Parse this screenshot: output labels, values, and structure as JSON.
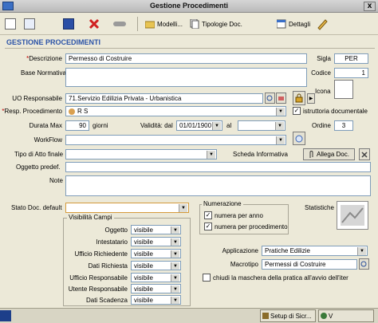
{
  "window": {
    "title": "Gestione Procedimenti",
    "close_glyph": "x"
  },
  "toolbar": {
    "items": [
      {
        "name": "new-icon"
      },
      {
        "name": "new-copy-icon"
      },
      {
        "name": "save-icon"
      },
      {
        "name": "delete-icon"
      },
      {
        "name": "handshake-icon"
      }
    ],
    "modelli_label": "Modelli...",
    "tipologie_label": "Tipologie Doc.",
    "dettagli_label": "Dettagli"
  },
  "section_title": "GESTIONE PROCEDIMENTI",
  "form": {
    "descrizione_required": "*",
    "descrizione_label": "Descrizione",
    "descrizione_value": "Permesso di Costruire",
    "sigla_label": "Sigla",
    "sigla_value": "PER",
    "base_normativa_label": "Base Normativa",
    "codice_label": "Codice",
    "codice_value": "1",
    "icona_label": "Icona",
    "uo_label": "UO Responsabile",
    "uo_value": "71.Servizio Edilizia Privata -  Urbanistica",
    "resp_required": "*",
    "resp_label": "Resp. Procedimento",
    "resp_value": "R          S",
    "istruttoria_label": "istruttoria documentale",
    "istruttoria_checked": true,
    "durata_label": "Durata Max",
    "durata_value": "90",
    "giorni_label": "giorni",
    "validita_label": "Validità: dal",
    "validita_dal": "01/01/1900",
    "al_label": "al",
    "validita_al": "",
    "ordine_label": "Ordine",
    "ordine_value": "3",
    "workflow_label": "WorkFlow",
    "workflow_value": "",
    "tipo_atto_label": "Tipo di Atto finale",
    "tipo_atto_value": "",
    "scheda_label": "Scheda Informativa",
    "allega_label": "Allega Doc.",
    "oggetto_predef_label": "Oggetto predef.",
    "note_label": "Note",
    "stato_label": "Stato Doc. default",
    "stato_value": ""
  },
  "visibilita": {
    "title": "Visibilità Campi",
    "rows": [
      {
        "label": "Oggetto",
        "value": "visibile"
      },
      {
        "label": "Intestatario",
        "value": "visibile"
      },
      {
        "label": "Ufficio Richiedente",
        "value": "visibile"
      },
      {
        "label": "Dati Richiesta",
        "value": "visibile"
      },
      {
        "label": "Ufficio Responsabile",
        "value": "visibile"
      },
      {
        "label": "Utente Responsabile",
        "value": "visibile"
      },
      {
        "label": "Dati Scadenza",
        "value": "visibile"
      }
    ]
  },
  "numerazione": {
    "title": "Numerazione",
    "per_anno_label": "numera per anno",
    "per_anno_checked": true,
    "per_procedimento_label": "numera per procedimento",
    "per_procedimento_checked": true
  },
  "statistiche_label": "Statistiche",
  "applicazione": {
    "label": "Applicazione",
    "value": "Pratiche Edilizie",
    "macrotipo_label": "Macrotipo",
    "macrotipo_value": "Permessi di Costruire",
    "chiudi_label": "chiudi la maschera della pratica all'avvio dell'iter",
    "chiudi_checked": false
  },
  "statusbar": {
    "setup_label": "Setup di Sicr...",
    "v_label": "V"
  },
  "colors": {
    "accent_title": "#2c54a8",
    "required": "#c00000",
    "field_border": "#7f9db9"
  }
}
